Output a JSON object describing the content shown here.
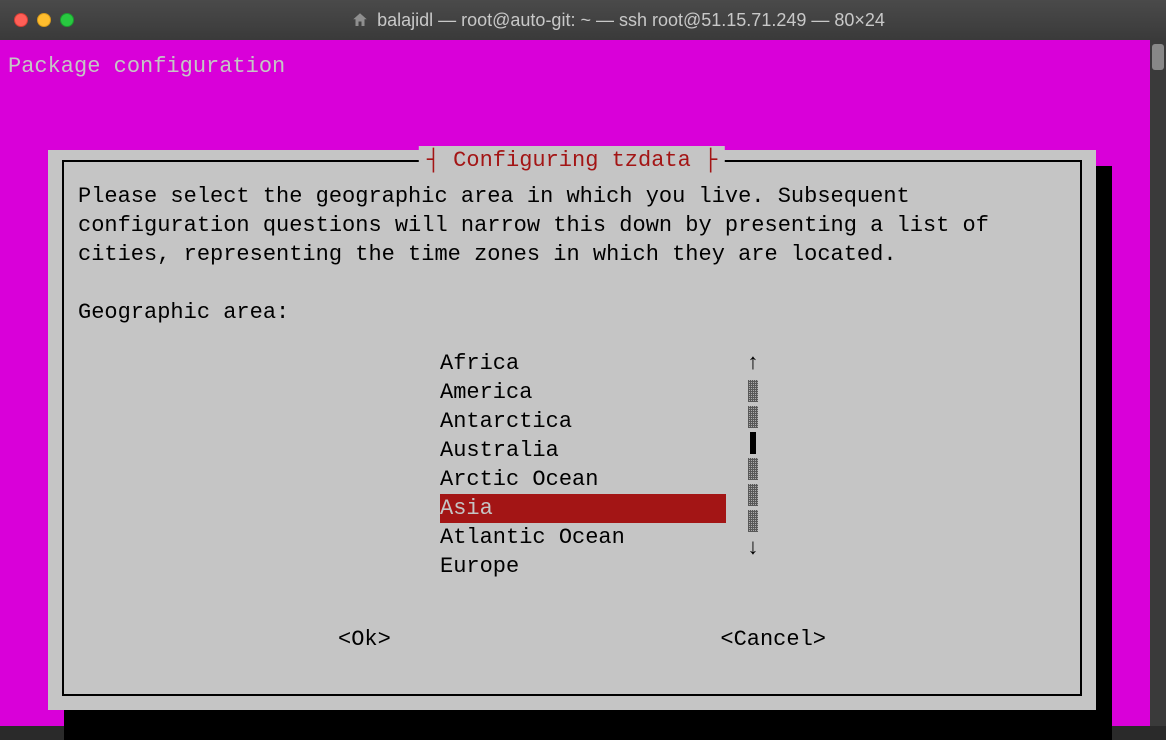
{
  "window": {
    "title": "balajidl — root@auto-git: ~ — ssh root@51.15.71.249 — 80×24"
  },
  "terminal": {
    "header": "Package configuration"
  },
  "dialog": {
    "title": "Configuring tzdata",
    "text": "Please select the geographic area in which you live. Subsequent configuration questions will narrow this down by presenting a list of cities, representing the time zones in which they are located.",
    "prompt": "Geographic area:",
    "items": [
      "Africa",
      "America",
      "Antarctica",
      "Australia",
      "Arctic Ocean",
      "Asia",
      "Atlantic Ocean",
      "Europe"
    ],
    "selected_index": 5,
    "ok_label": "<Ok>",
    "cancel_label": "<Cancel>",
    "scroll_up": "↑",
    "scroll_down": "↓"
  }
}
